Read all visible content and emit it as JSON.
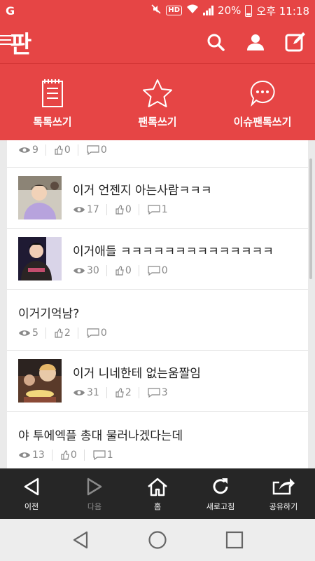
{
  "status_bar": {
    "carrier": "G",
    "battery": "20%",
    "time": "오후 11:18",
    "hd": "HD",
    "icons": [
      "mute-icon",
      "wifi-icon",
      "signal-icon",
      "battery-icon"
    ]
  },
  "header": {
    "logo": "판",
    "icons": [
      "menu-icon",
      "search-icon",
      "user-icon",
      "edit-icon"
    ]
  },
  "write_tabs": [
    {
      "label": "톡톡쓰기",
      "icon": "notepad-icon"
    },
    {
      "label": "팬톡쓰기",
      "icon": "star-icon"
    },
    {
      "label": "이슈팬톡쓰기",
      "icon": "chat-bubble-icon"
    }
  ],
  "posts": [
    {
      "title": "",
      "views": "9",
      "likes": "0",
      "comments": "0",
      "thumb": "none"
    },
    {
      "title": "이거 언젠지 아는사람ㅋㅋㅋ",
      "views": "17",
      "likes": "0",
      "comments": "1",
      "thumb": "photo"
    },
    {
      "title": "이거애들 ㅋㅋㅋㅋㅋㅋㅋㅋㅋㅋㅋㅋㅋㅋ",
      "views": "30",
      "likes": "0",
      "comments": "0",
      "thumb": "photo"
    },
    {
      "title": "이거기억남?",
      "views": "5",
      "likes": "2",
      "comments": "0",
      "thumb": "none"
    },
    {
      "title": "이거 니네한테 없는움짤임",
      "views": "31",
      "likes": "2",
      "comments": "3",
      "thumb": "photo"
    },
    {
      "title": "야 투에엑플 총대 물러나겠다는데",
      "views": "13",
      "likes": "0",
      "comments": "1",
      "thumb": "none"
    }
  ],
  "browser_nav": [
    {
      "label": "이전",
      "icon": "back-triangle-icon"
    },
    {
      "label": "다음",
      "icon": "forward-triangle-icon"
    },
    {
      "label": "홈",
      "icon": "home-icon"
    },
    {
      "label": "새로고침",
      "icon": "refresh-icon"
    },
    {
      "label": "공유하기",
      "icon": "share-icon"
    }
  ],
  "colors": {
    "brand": "#e64545",
    "nav_dark": "#262626",
    "meta_text": "#888888"
  }
}
